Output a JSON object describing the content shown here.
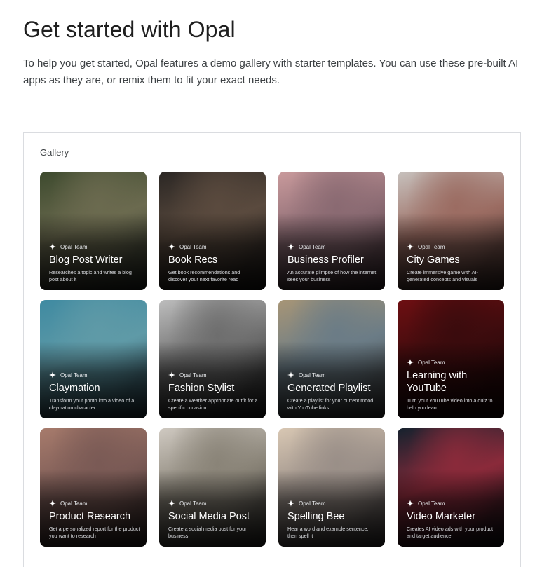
{
  "page": {
    "title": "Get started with Opal",
    "intro": "To help you get started, Opal features a demo gallery with starter templates. You can use these pre-built AI apps as they are, or remix them to fit your exact needs."
  },
  "gallery": {
    "label": "Gallery",
    "cards": [
      {
        "author": "Opal Team",
        "title": "Blog Post Writer",
        "description": "Researches a topic and writes a blog post about it",
        "icon": "sparkle-icon",
        "colors": [
          "#3d4a2e",
          "#6b6a4f",
          "#2a2f28"
        ]
      },
      {
        "author": "Opal Team",
        "title": "Book Recs",
        "description": "Get book recommendations and discover your next favorite read",
        "icon": "sparkle-icon",
        "colors": [
          "#2b2724",
          "#5a4a3e",
          "#1b1918"
        ]
      },
      {
        "author": "Opal Team",
        "title": "Business Profiler",
        "description": "An accurate glimpse of how the internet sees your business",
        "icon": "sparkle-icon",
        "colors": [
          "#c99a9c",
          "#8a6a72",
          "#3a2a30"
        ]
      },
      {
        "author": "Opal Team",
        "title": "City Games",
        "description": "Create immersive game with AI-generated concepts and visuals",
        "icon": "sparkle-icon",
        "colors": [
          "#c7c1bd",
          "#9b6c62",
          "#3e2c28"
        ]
      },
      {
        "author": "Opal Team",
        "title": "Claymation",
        "description": "Transform your photo into a video of a claymation character",
        "icon": "sparkle-icon",
        "colors": [
          "#3f8aa1",
          "#5f9aa7",
          "#243a44"
        ]
      },
      {
        "author": "Opal Team",
        "title": "Fashion Stylist",
        "description": "Create a weather appropriate outfit for a specific occasion",
        "icon": "sparkle-icon",
        "colors": [
          "#bdbdbd",
          "#6e6e6e",
          "#1c1c1c"
        ]
      },
      {
        "author": "Opal Team",
        "title": "Generated Playlist",
        "description": "Create a playlist for your current mood with YouTube links",
        "icon": "sparkle-icon",
        "colors": [
          "#a79576",
          "#6b7c86",
          "#3a3a3a"
        ]
      },
      {
        "author": "Opal Team",
        "title": "Learning with YouTube",
        "description": "Turn your YouTube video into a quiz to help you learn",
        "icon": "sparkle-icon",
        "colors": [
          "#6e0f12",
          "#3a0b0d",
          "#160405"
        ]
      },
      {
        "author": "Opal Team",
        "title": "Product Research",
        "description": "Get a personalized report for the product you want to research",
        "icon": "sparkle-icon",
        "colors": [
          "#a77b6c",
          "#7a5a55",
          "#2e2322"
        ]
      },
      {
        "author": "Opal Team",
        "title": "Social Media Post",
        "description": "Create a social media post for your business",
        "icon": "sparkle-icon",
        "colors": [
          "#cfc9c1",
          "#8a8478",
          "#2e2d2a"
        ]
      },
      {
        "author": "Opal Team",
        "title": "Spelling Bee",
        "description": "Hear a word and example sentence, then spell it",
        "icon": "sparkle-icon",
        "colors": [
          "#d8c7b3",
          "#9a8f88",
          "#3a3636"
        ]
      },
      {
        "author": "Opal Team",
        "title": "Video Marketer",
        "description": "Creates AI video ads with your product and target audience",
        "icon": "sparkle-icon",
        "colors": [
          "#15222e",
          "#8a2a3a",
          "#0c0f14"
        ]
      }
    ]
  }
}
